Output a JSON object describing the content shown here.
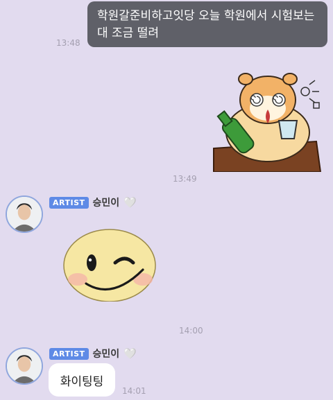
{
  "messages": {
    "outgoing_text": "학원갈준비하고잇당 오늘 학원에서 시험보는대 조금 떨려",
    "outgoing_time": "13:48",
    "sticker_hamster_time": "13:49",
    "artist_block1": {
      "badge": "ARTIST",
      "name": "승민이",
      "heart": "🤍",
      "time": "14:00"
    },
    "artist_block2": {
      "badge": "ARTIST",
      "name": "승민이",
      "heart": "🤍",
      "text": "화이팅팅",
      "time": "14:01"
    }
  },
  "colors": {
    "background": "#e2dbef",
    "outgoing_bubble": "#5f6068",
    "badge": "#5e8ae6",
    "incoming_bubble": "#ffffff"
  }
}
